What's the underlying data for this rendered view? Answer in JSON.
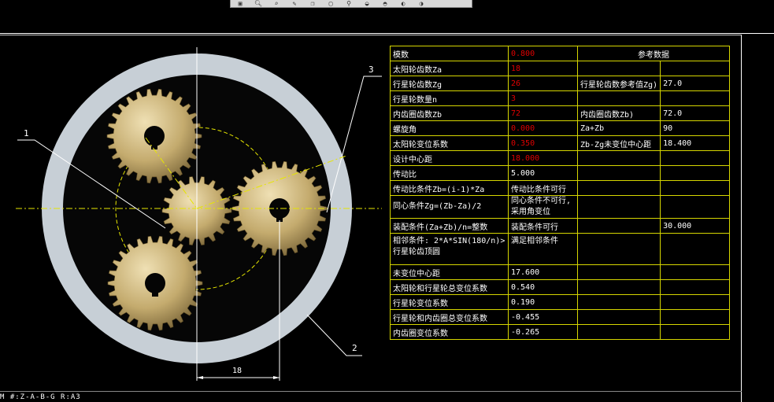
{
  "toolbar": {
    "icons": [
      "zoom-window-icon",
      "zoom-in-icon",
      "zoom-out-icon",
      "edit-icon",
      "copy-icon",
      "page-icon",
      "walk-icon",
      "view1-icon",
      "view2-icon",
      "view3-icon",
      "view4-icon"
    ]
  },
  "callouts": {
    "c1": "1",
    "c2": "2",
    "c3": "3"
  },
  "dimension": {
    "label": "18"
  },
  "statusbar": {
    "text": "M  #:Z-A-B-G  R:A3"
  },
  "table": {
    "header": "参考数据",
    "rows": [
      {
        "label": "模数",
        "value": "0.800",
        "ref_label": "",
        "ref_value": ""
      },
      {
        "label": "太阳轮齿数Za",
        "value": "18",
        "ref_label": "",
        "ref_value": ""
      },
      {
        "label": "行星轮齿数Zg",
        "value": "26",
        "ref_label": "行星轮齿数参考值Zg)",
        "ref_value": "27.0"
      },
      {
        "label": "行星轮数量n",
        "value": "3",
        "ref_label": "",
        "ref_value": ""
      },
      {
        "label": "内齿圈齿数Zb",
        "value": "72",
        "ref_label": "内齿圈齿数Zb)",
        "ref_value": "72.0"
      },
      {
        "label": "螺旋角",
        "value": "0.000",
        "ref_label": "Za+Zb",
        "ref_value": "90"
      },
      {
        "label": "太阳轮变位系数",
        "value": "0.350",
        "ref_label": "Zb-Zg未变位中心距",
        "ref_value": "18.400"
      },
      {
        "label": "设计中心距",
        "value": "18.000",
        "ref_label": "",
        "ref_value": ""
      },
      {
        "label": "传动比",
        "value": "5.000",
        "ref_label": "",
        "ref_value": ""
      },
      {
        "label": "传动比条件Zb=(i-1)*Za",
        "value": "传动比条件可行",
        "ref_label": "",
        "ref_value": ""
      },
      {
        "label": "同心条件Zg=(Zb-Za)/2",
        "value": "同心条件不可行,采用角变位",
        "ref_label": "",
        "ref_value": ""
      },
      {
        "label": "装配条件(Za+Zb)/n=整数",
        "value": "装配条件可行",
        "ref_label": "",
        "ref_value": "30.000"
      },
      {
        "label": "相邻条件: 2*A*SIN(180/n)>行星轮齿顶圆",
        "value": "满足相邻条件",
        "ref_label": "",
        "ref_value": ""
      },
      {
        "label": "未变位中心距",
        "value": "17.600",
        "ref_label": "",
        "ref_value": ""
      },
      {
        "label": "太阳轮和行星轮总变位系数",
        "value": "0.540",
        "ref_label": "",
        "ref_value": ""
      },
      {
        "label": "行星轮变位系数",
        "value": "0.190",
        "ref_label": "",
        "ref_value": ""
      },
      {
        "label": "行星轮和内齿圈总变位系数",
        "value": "-0.455",
        "ref_label": "",
        "ref_value": ""
      },
      {
        "label": "内齿圈变位系数",
        "value": "-0.265",
        "ref_label": "",
        "ref_value": ""
      }
    ]
  },
  "colors": {
    "ring": "#c7cfd6",
    "gear": "#c9b37a",
    "gear_dark": "#8a7442",
    "table_border": "#d6d600",
    "input_value": "#e00000",
    "centerline": "#e6e600"
  }
}
